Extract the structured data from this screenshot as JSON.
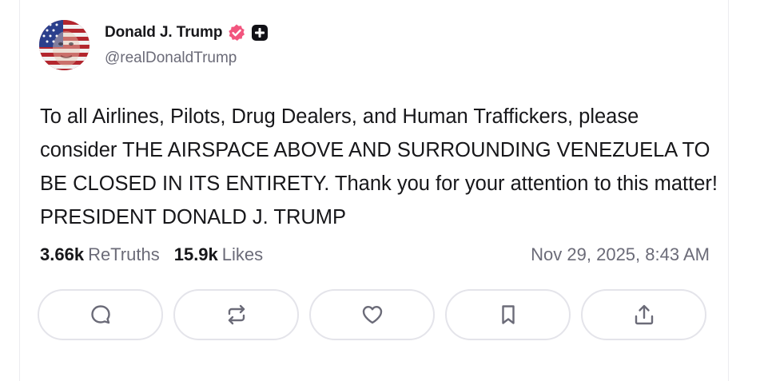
{
  "author": {
    "display_name": "Donald J. Trump",
    "handle": "@realDonaldTrump",
    "verified_color": "#f2557e",
    "avatar_icon": "flag-portrait-avatar"
  },
  "post": {
    "text": "To all Airlines, Pilots, Drug Dealers, and Human Traffickers, please consider THE AIRSPACE ABOVE AND SURROUNDING VENEZUELA TO BE CLOSED IN ITS ENTIRETY. Thank you for your attention to this matter! PRESIDENT DONALD J. TRUMP",
    "timestamp": "Nov 29, 2025, 8:43 AM"
  },
  "stats": {
    "retruths_count": "3.66k",
    "retruths_label": "ReTruths",
    "likes_count": "15.9k",
    "likes_label": "Likes"
  },
  "actions": [
    {
      "icon": "reply-icon"
    },
    {
      "icon": "retruth-icon"
    },
    {
      "icon": "like-icon"
    },
    {
      "icon": "bookmark-icon"
    },
    {
      "icon": "share-icon"
    }
  ],
  "colors": {
    "text": "#17171a",
    "muted": "#6b6b78",
    "button_border": "#e4e4ea",
    "icon": "#6b6b78"
  }
}
